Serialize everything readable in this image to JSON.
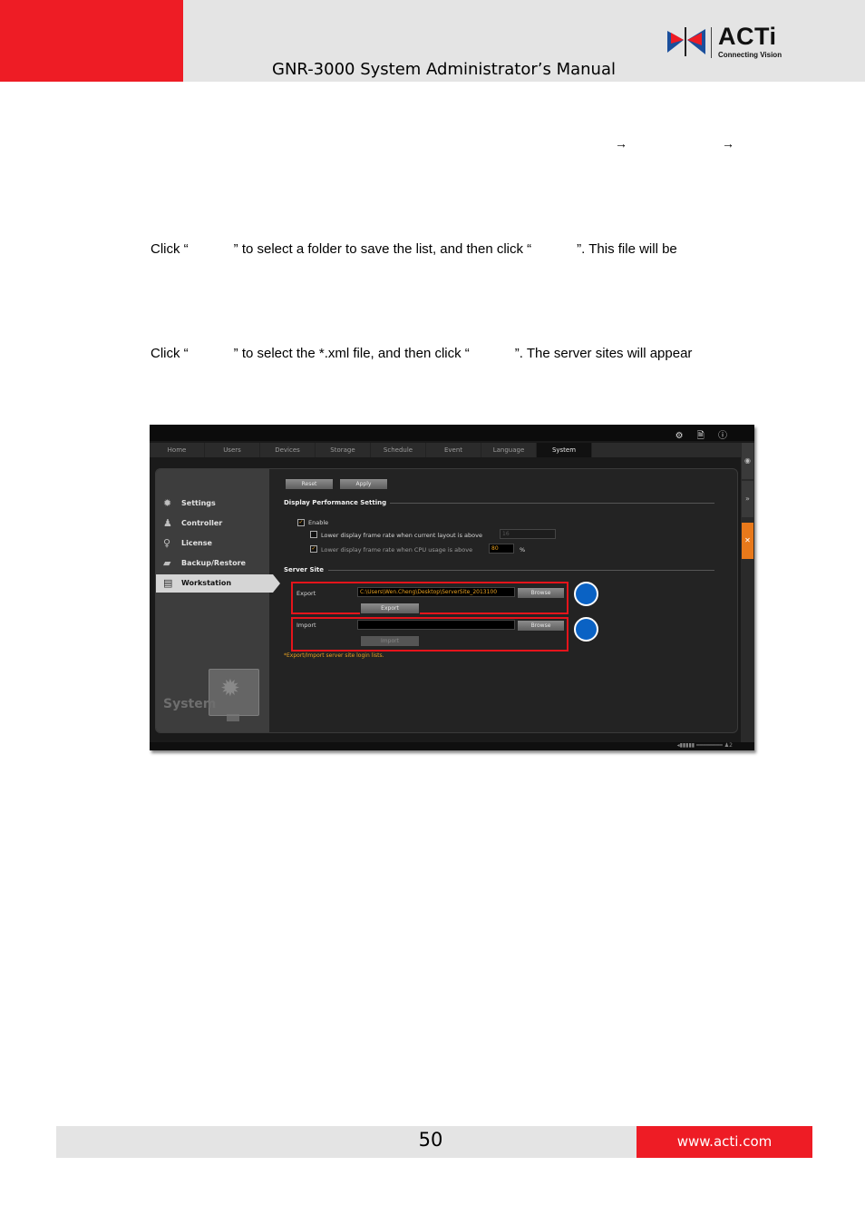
{
  "header": {
    "title": "GNR-3000 System Administrator’s Manual",
    "logo_text": "ACTi",
    "logo_tagline": "Connecting Vision"
  },
  "body_text": {
    "arrow_glyph": "→",
    "export_instruction": "Click “            ” to select a folder to save the list, and then click “            ”. This file will be",
    "import_instruction": "Click “            ” to select the *.xml file, and then click “            ”. The server sites will appear"
  },
  "screenshot": {
    "top_icons": "⚙ 🗎 ⓘ",
    "tabs": [
      "Home",
      "Users",
      "Devices",
      "Storage",
      "Schedule",
      "Event",
      "Language",
      "System"
    ],
    "active_tab": "System",
    "sidebar": {
      "items": [
        {
          "label": "Settings",
          "icon": "gear-icon"
        },
        {
          "label": "Controller",
          "icon": "joystick-icon"
        },
        {
          "label": "License",
          "icon": "key-icon"
        },
        {
          "label": "Backup/Restore",
          "icon": "folder-icon"
        },
        {
          "label": "Workstation",
          "icon": "workstation-icon"
        }
      ],
      "active_item": "Workstation",
      "footer_label": "System"
    },
    "toolbar": {
      "reset_label": "Reset",
      "apply_label": "Apply"
    },
    "display_performance": {
      "heading": "Display Performance Setting",
      "enable_label": "Enable",
      "enable_checked": true,
      "frame_rate_layout_label": "Lower display frame rate when current layout is above",
      "frame_rate_layout_value": "16",
      "cpu_usage_label": "Lower display frame rate when CPU usage is above",
      "cpu_usage_value": "80",
      "cpu_usage_unit": "%"
    },
    "server_site": {
      "heading": "Server Site",
      "export_label": "Export",
      "export_path": "C:\\Users\\Wen.Cheng\\Desktop\\ServerSite_2013100",
      "browse_label": "Browse",
      "export_button": "Export",
      "import_label": "Import",
      "import_path": "",
      "import_button": "Import",
      "note": "*Export/Import server site login lists."
    },
    "colors": {
      "accent_orange": "#e8791b",
      "highlight_red": "#e5141b",
      "callout_blue": "#0a62c4"
    }
  },
  "footer": {
    "page_number": "50",
    "url": "www.acti.com"
  }
}
